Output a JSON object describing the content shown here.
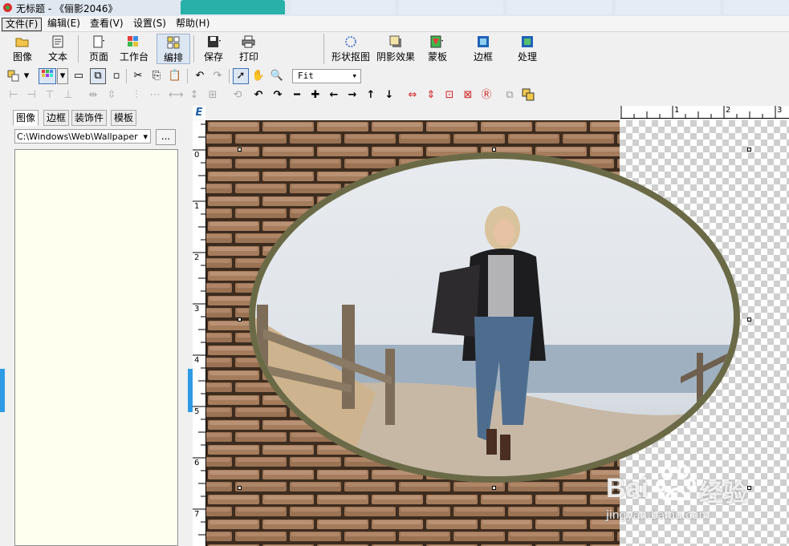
{
  "window": {
    "title": "无标题 - 《俪影2046》",
    "background_tabs": 6
  },
  "menu": [
    {
      "id": "file",
      "label": "文件(F)"
    },
    {
      "id": "edit",
      "label": "编辑(E)"
    },
    {
      "id": "view",
      "label": "查看(V)"
    },
    {
      "id": "settings",
      "label": "设置(S)"
    },
    {
      "id": "help",
      "label": "帮助(H)"
    }
  ],
  "toolbar": {
    "image": "图像",
    "text": "文本",
    "page": "页面",
    "workbench": "工作台",
    "layout": "编排",
    "save": "保存",
    "print": "打印",
    "shape_cutout": "形状抠图",
    "shadow_effect": "阴影效果",
    "mask": "蒙板",
    "border": "边框",
    "process": "处理"
  },
  "zoom": {
    "value": "Fit"
  },
  "left_panel": {
    "tabs": [
      "图像",
      "边框",
      "装饰件",
      "模板"
    ],
    "path": "C:\\Windows\\Web\\Wallpaper",
    "browse_label": "..."
  },
  "ruler": {
    "corner": "E",
    "h_ticks": [
      "1",
      "2",
      "3"
    ],
    "v_ticks": [
      "0",
      "1",
      "2",
      "3",
      "4",
      "5",
      "6",
      "7"
    ]
  },
  "watermark": {
    "brand": "Bai",
    "brand_cn": "经验",
    "url": "jingyan.baidu.com"
  },
  "colors": {
    "frame": "#6b6a47",
    "accent_blue": "#2e9be4",
    "file_list_bg": "#fffff0"
  }
}
